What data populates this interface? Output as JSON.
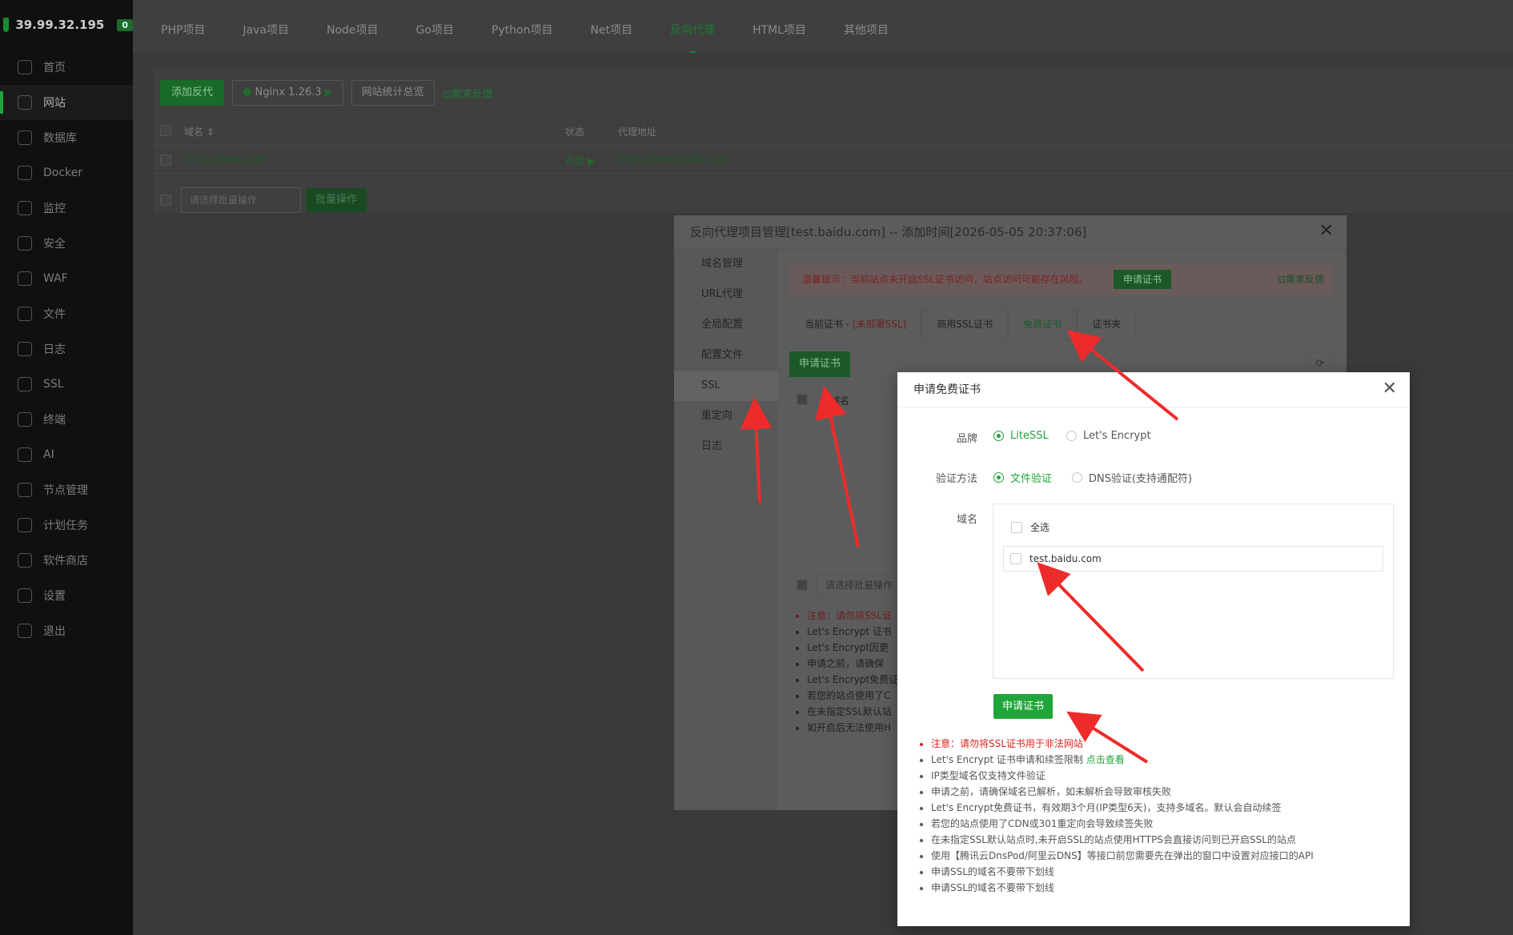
{
  "sidebar": {
    "ip": "39.99.32.195",
    "badge": "0",
    "items": [
      {
        "label": "首页"
      },
      {
        "label": "网站"
      },
      {
        "label": "数据库"
      },
      {
        "label": "Docker"
      },
      {
        "label": "监控"
      },
      {
        "label": "安全"
      },
      {
        "label": "WAF"
      },
      {
        "label": "文件"
      },
      {
        "label": "日志"
      },
      {
        "label": "SSL"
      },
      {
        "label": "终端"
      },
      {
        "label": "AI"
      },
      {
        "label": "节点管理"
      },
      {
        "label": "计划任务"
      },
      {
        "label": "软件商店"
      },
      {
        "label": "设置"
      },
      {
        "label": "退出"
      }
    ],
    "active_index": 1
  },
  "top_tabs": [
    "PHP项目",
    "Java项目",
    "Node项目",
    "Go项目",
    "Python项目",
    "Net项目",
    "反向代理",
    "HTML项目",
    "其他项目"
  ],
  "top_tabs_active": "反向代理",
  "toolbar": {
    "add_btn": "添加反代",
    "nginx": "Nginx 1.26.3",
    "stats_btn": "网站统计总览",
    "feedback": "需求反馈"
  },
  "table": {
    "col_domain": "域名",
    "col_status": "状态",
    "col_proxy": "代理地址",
    "rows": [
      {
        "domain": "test.baidu.com",
        "status": "开启",
        "proxy": "https://www.baidu.com"
      }
    ],
    "batch_placeholder": "请选择批量操作",
    "batch_btn": "批量操作"
  },
  "proj_dialog": {
    "title": "反向代理项目管理[test.baidu.com] -- 添加时间[2026-05-05 20:37:06]",
    "nav": [
      "域名管理",
      "URL代理",
      "全局配置",
      "配置文件",
      "SSL",
      "重定向",
      "日志"
    ],
    "nav_active": "SSL",
    "warn_text": "温馨提示：当前站点未开启SSL证书访问，站点访问可能存在风险。",
    "warn_btn": "申请证书",
    "warn_feedback": "需求反馈",
    "ssl_tabs": {
      "current_prefix": "当前证书 - ",
      "current_status": "[未部署SSL]",
      "commercial": "商用SSL证书",
      "free": "免费证书",
      "folder": "证书夹"
    },
    "apply_btn": "申请证书",
    "col_domain": "域名",
    "batch_placeholder": "请选择批量操作",
    "notes": [
      "注意：请勿将SSL证",
      "Let's Encrypt 证书",
      "Let's Encrypt因更",
      "申请之前，请确保",
      "Let's Encrypt免费证",
      "若您的站点使用了C",
      "在未指定SSL默认站",
      "如开启后无法使用H"
    ]
  },
  "ssl_dialog": {
    "title": "申请免费证书",
    "brand_label": "品牌",
    "brand_options": [
      "LiteSSL",
      "Let's Encrypt"
    ],
    "brand_selected": "LiteSSL",
    "verify_label": "验证方法",
    "verify_options": [
      "文件验证",
      "DNS验证(支持通配符)"
    ],
    "verify_selected": "文件验证",
    "domain_label": "域名",
    "select_all": "全选",
    "domains": [
      "test.baidu.com"
    ],
    "apply_btn": "申请证书",
    "notes": {
      "warning": "注意：请勿将SSL证书用于非法网站",
      "le_limit": "Let's Encrypt 证书申请和续签限制 ",
      "le_limit_link": "点击查看",
      "items": [
        "IP类型域名仅支持文件验证",
        "申请之前，请确保域名已解析，如未解析会导致审核失败",
        "Let's Encrypt免费证书，有效期3个月(IP类型6天)，支持多域名。默认会自动续签",
        "若您的站点使用了CDN或301重定向会导致续签失败",
        "在未指定SSL默认站点时,未开启SSL的站点使用HTTPS会直接访问到已开启SSL的站点",
        "使用【腾讯云DnsPod/阿里云DNS】等接口前您需要先在弹出的窗口中设置对应接口的API",
        "申请SSL的域名不要带下划线",
        "申请SSL的域名不要带下划线"
      ]
    }
  },
  "colors": {
    "accent": "#20a53a",
    "warning": "#e02020",
    "annotation_arrow": "#ee2b2b"
  }
}
